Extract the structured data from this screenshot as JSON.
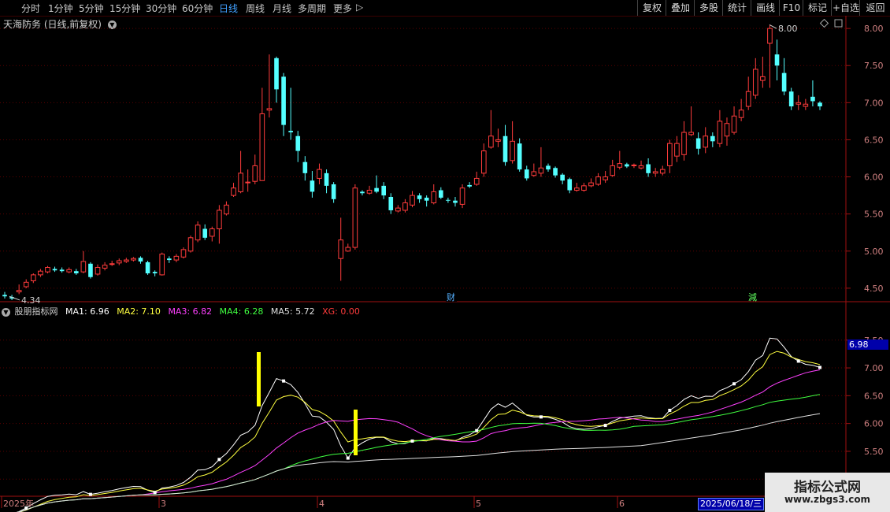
{
  "toolbar": {
    "left_items": [
      "分时",
      "1分钟",
      "5分钟",
      "15分钟",
      "30分钟",
      "60分钟",
      "日线",
      "周线",
      "月线",
      "多周期",
      "更多"
    ],
    "active": "日线",
    "right_items": [
      "复权",
      "叠加",
      "多股",
      "统计",
      "画线",
      "F10",
      "标记",
      "+自选",
      "返回"
    ]
  },
  "stock": {
    "title": "天海防务 (日线,前复权)",
    "high_label": "8.00",
    "low_label": "4.34",
    "markers": {
      "cai": "财",
      "jian": "減"
    }
  },
  "price_axis": [
    "8.00",
    "7.50",
    "7.00",
    "6.50",
    "6.00",
    "5.50",
    "5.00",
    "4.50"
  ],
  "indicator": {
    "name": "股朋指标网",
    "ma1": "MA1: 6.96",
    "ma2": "MA2: 7.10",
    "ma3": "MA3: 6.82",
    "ma4": "MA4: 6.28",
    "ma5": "MA5: 5.72",
    "xg": "XG: 0.00",
    "axis": [
      "7.50",
      "7.00",
      "6.50",
      "6.00",
      "5.50",
      "5.00"
    ],
    "current_value": "6.98"
  },
  "time_axis": [
    "2025年",
    "3",
    "4",
    "5",
    "6"
  ],
  "date_tag": "2025/06/18/三",
  "watermark": {
    "line1": "指标公式网",
    "line2": "www.zbgs3.com"
  },
  "colors": {
    "up": "#ff3c3c",
    "down": "#54ffff",
    "ma1": "#ffffff",
    "ma2": "#ffff40",
    "ma3": "#ff40ff",
    "ma4": "#40ff40",
    "ma5": "#e0e0e0",
    "xg": "#ff3c3c",
    "signal": "#ffff00"
  },
  "chart_data": {
    "type": "candlestick",
    "candles": [
      [
        4.41,
        4.39,
        4.45,
        4.36
      ],
      [
        4.38,
        4.36,
        4.41,
        4.34
      ],
      [
        4.45,
        4.47,
        4.55,
        4.42
      ],
      [
        4.52,
        4.58,
        4.62,
        4.5
      ],
      [
        4.6,
        4.68,
        4.7,
        4.57
      ],
      [
        4.68,
        4.73,
        4.76,
        4.65
      ],
      [
        4.72,
        4.78,
        4.8,
        4.7
      ],
      [
        4.76,
        4.74,
        4.79,
        4.72
      ],
      [
        4.75,
        4.73,
        4.78,
        4.71
      ],
      [
        4.72,
        4.75,
        4.78,
        4.7
      ],
      [
        4.73,
        4.7,
        4.76,
        4.68
      ],
      [
        4.72,
        4.86,
        5.0,
        4.7
      ],
      [
        4.83,
        4.65,
        4.85,
        4.63
      ],
      [
        4.69,
        4.78,
        4.82,
        4.67
      ],
      [
        4.77,
        4.81,
        4.85,
        4.74
      ],
      [
        4.82,
        4.83,
        4.87,
        4.8
      ],
      [
        4.84,
        4.87,
        4.9,
        4.81
      ],
      [
        4.86,
        4.88,
        4.91,
        4.84
      ],
      [
        4.88,
        4.9,
        4.92,
        4.86
      ],
      [
        4.91,
        4.86,
        4.93,
        4.83
      ],
      [
        4.85,
        4.7,
        4.87,
        4.68
      ],
      [
        4.72,
        4.7,
        4.74,
        4.66
      ],
      [
        4.68,
        4.96,
        4.98,
        4.67
      ],
      [
        4.9,
        4.88,
        4.93,
        4.84
      ],
      [
        4.88,
        4.93,
        4.96,
        4.85
      ],
      [
        4.92,
        5.02,
        5.05,
        4.9
      ],
      [
        5.0,
        5.18,
        5.21,
        4.98
      ],
      [
        5.15,
        5.35,
        5.4,
        5.12
      ],
      [
        5.3,
        5.18,
        5.36,
        5.15
      ],
      [
        5.2,
        5.3,
        5.33,
        5.13
      ],
      [
        5.3,
        5.55,
        5.62,
        5.1
      ],
      [
        5.5,
        5.62,
        5.67,
        5.48
      ],
      [
        5.75,
        5.85,
        5.92,
        5.73
      ],
      [
        5.8,
        6.05,
        6.35,
        5.78
      ],
      [
        5.92,
        5.93,
        6.1,
        5.8
      ],
      [
        5.94,
        6.15,
        6.3,
        5.9
      ],
      [
        5.95,
        6.85,
        7.2,
        5.95
      ],
      [
        6.9,
        6.92,
        7.65,
        6.8
      ],
      [
        7.6,
        7.18,
        7.62,
        7.0
      ],
      [
        7.35,
        6.7,
        7.4,
        6.55
      ],
      [
        6.62,
        6.6,
        7.2,
        6.5
      ],
      [
        6.55,
        6.35,
        6.62,
        6.2
      ],
      [
        6.2,
        6.05,
        6.28,
        5.95
      ],
      [
        5.95,
        5.8,
        6.08,
        5.72
      ],
      [
        5.98,
        6.1,
        6.18,
        5.9
      ],
      [
        6.05,
        5.88,
        6.1,
        5.78
      ],
      [
        5.9,
        5.7,
        5.93,
        5.65
      ],
      [
        4.9,
        5.15,
        5.45,
        4.6
      ],
      [
        5.0,
        5.05,
        5.1,
        4.99
      ],
      [
        5.05,
        5.85,
        5.9,
        5.02
      ],
      [
        5.8,
        5.78,
        5.82,
        5.75
      ],
      [
        5.78,
        5.82,
        5.88,
        5.76
      ],
      [
        5.85,
        5.8,
        6.02,
        5.78
      ],
      [
        5.88,
        5.75,
        5.93,
        5.7
      ],
      [
        5.73,
        5.55,
        5.78,
        5.5
      ],
      [
        5.54,
        5.58,
        5.62,
        5.52
      ],
      [
        5.55,
        5.65,
        5.7,
        5.52
      ],
      [
        5.62,
        5.75,
        5.81,
        5.59
      ],
      [
        5.75,
        5.7,
        5.78,
        5.65
      ],
      [
        5.72,
        5.68,
        5.75,
        5.6
      ],
      [
        5.65,
        5.8,
        5.9,
        5.63
      ],
      [
        5.82,
        5.72,
        5.86,
        5.7
      ],
      [
        5.69,
        5.68,
        5.72,
        5.65
      ],
      [
        5.68,
        5.65,
        5.73,
        5.6
      ],
      [
        5.63,
        5.85,
        5.9,
        5.58
      ],
      [
        5.89,
        5.87,
        5.93,
        5.85
      ],
      [
        5.9,
        5.98,
        6.07,
        5.88
      ],
      [
        6.05,
        6.35,
        6.45,
        6.0
      ],
      [
        6.4,
        6.55,
        6.9,
        6.38
      ],
      [
        6.48,
        6.5,
        6.65,
        6.4
      ],
      [
        6.55,
        6.2,
        6.7,
        6.15
      ],
      [
        6.22,
        6.48,
        6.75,
        6.18
      ],
      [
        6.45,
        6.1,
        6.52,
        6.07
      ],
      [
        6.1,
        5.98,
        6.15,
        5.95
      ],
      [
        6.02,
        6.07,
        6.18,
        6.0
      ],
      [
        6.05,
        6.12,
        6.4,
        6.0
      ],
      [
        6.15,
        6.1,
        6.18,
        6.07
      ],
      [
        6.12,
        6.02,
        6.14,
        5.99
      ],
      [
        6.03,
        5.95,
        6.05,
        5.9
      ],
      [
        5.97,
        5.82,
        5.99,
        5.78
      ],
      [
        5.82,
        5.85,
        5.92,
        5.8
      ],
      [
        5.82,
        5.88,
        5.92,
        5.8
      ],
      [
        5.88,
        5.92,
        5.98,
        5.86
      ],
      [
        5.9,
        6.0,
        6.05,
        5.88
      ],
      [
        5.96,
        6.0,
        6.08,
        5.92
      ],
      [
        6.02,
        6.15,
        6.23,
        6.0
      ],
      [
        6.13,
        6.18,
        6.35,
        6.1
      ],
      [
        6.17,
        6.14,
        6.19,
        6.12
      ],
      [
        6.15,
        6.16,
        6.18,
        6.12
      ],
      [
        6.12,
        6.15,
        6.22,
        6.1
      ],
      [
        6.17,
        6.05,
        6.25,
        6.0
      ],
      [
        6.05,
        6.07,
        6.12,
        6.0
      ],
      [
        6.05,
        6.1,
        6.15,
        6.02
      ],
      [
        6.15,
        6.45,
        6.5,
        6.05
      ],
      [
        6.28,
        6.45,
        6.55,
        6.2
      ],
      [
        6.3,
        6.6,
        6.75,
        6.22
      ],
      [
        6.57,
        6.6,
        6.95,
        6.55
      ],
      [
        6.52,
        6.38,
        6.6,
        6.3
      ],
      [
        6.4,
        6.55,
        6.67,
        6.32
      ],
      [
        6.55,
        6.48,
        6.6,
        6.4
      ],
      [
        6.45,
        6.75,
        6.9,
        6.4
      ],
      [
        6.55,
        6.72,
        6.8,
        6.42
      ],
      [
        6.6,
        6.82,
        6.95,
        6.57
      ],
      [
        6.8,
        6.9,
        7.05,
        6.75
      ],
      [
        6.95,
        7.15,
        7.35,
        6.9
      ],
      [
        7.1,
        7.45,
        7.6,
        7.05
      ],
      [
        7.3,
        7.35,
        7.62,
        7.2
      ],
      [
        7.8,
        8.0,
        8.05,
        7.2
      ],
      [
        7.65,
        7.5,
        7.85,
        7.3
      ],
      [
        7.4,
        7.15,
        7.6,
        7.1
      ],
      [
        7.15,
        6.95,
        7.2,
        6.9
      ],
      [
        6.98,
        7.0,
        7.1,
        6.9
      ],
      [
        6.95,
        6.98,
        7.05,
        6.9
      ],
      [
        7.08,
        7.02,
        7.3,
        6.95
      ],
      [
        7.0,
        6.95,
        7.02,
        6.9
      ]
    ],
    "ylim": [
      4.35,
      8.15
    ]
  }
}
